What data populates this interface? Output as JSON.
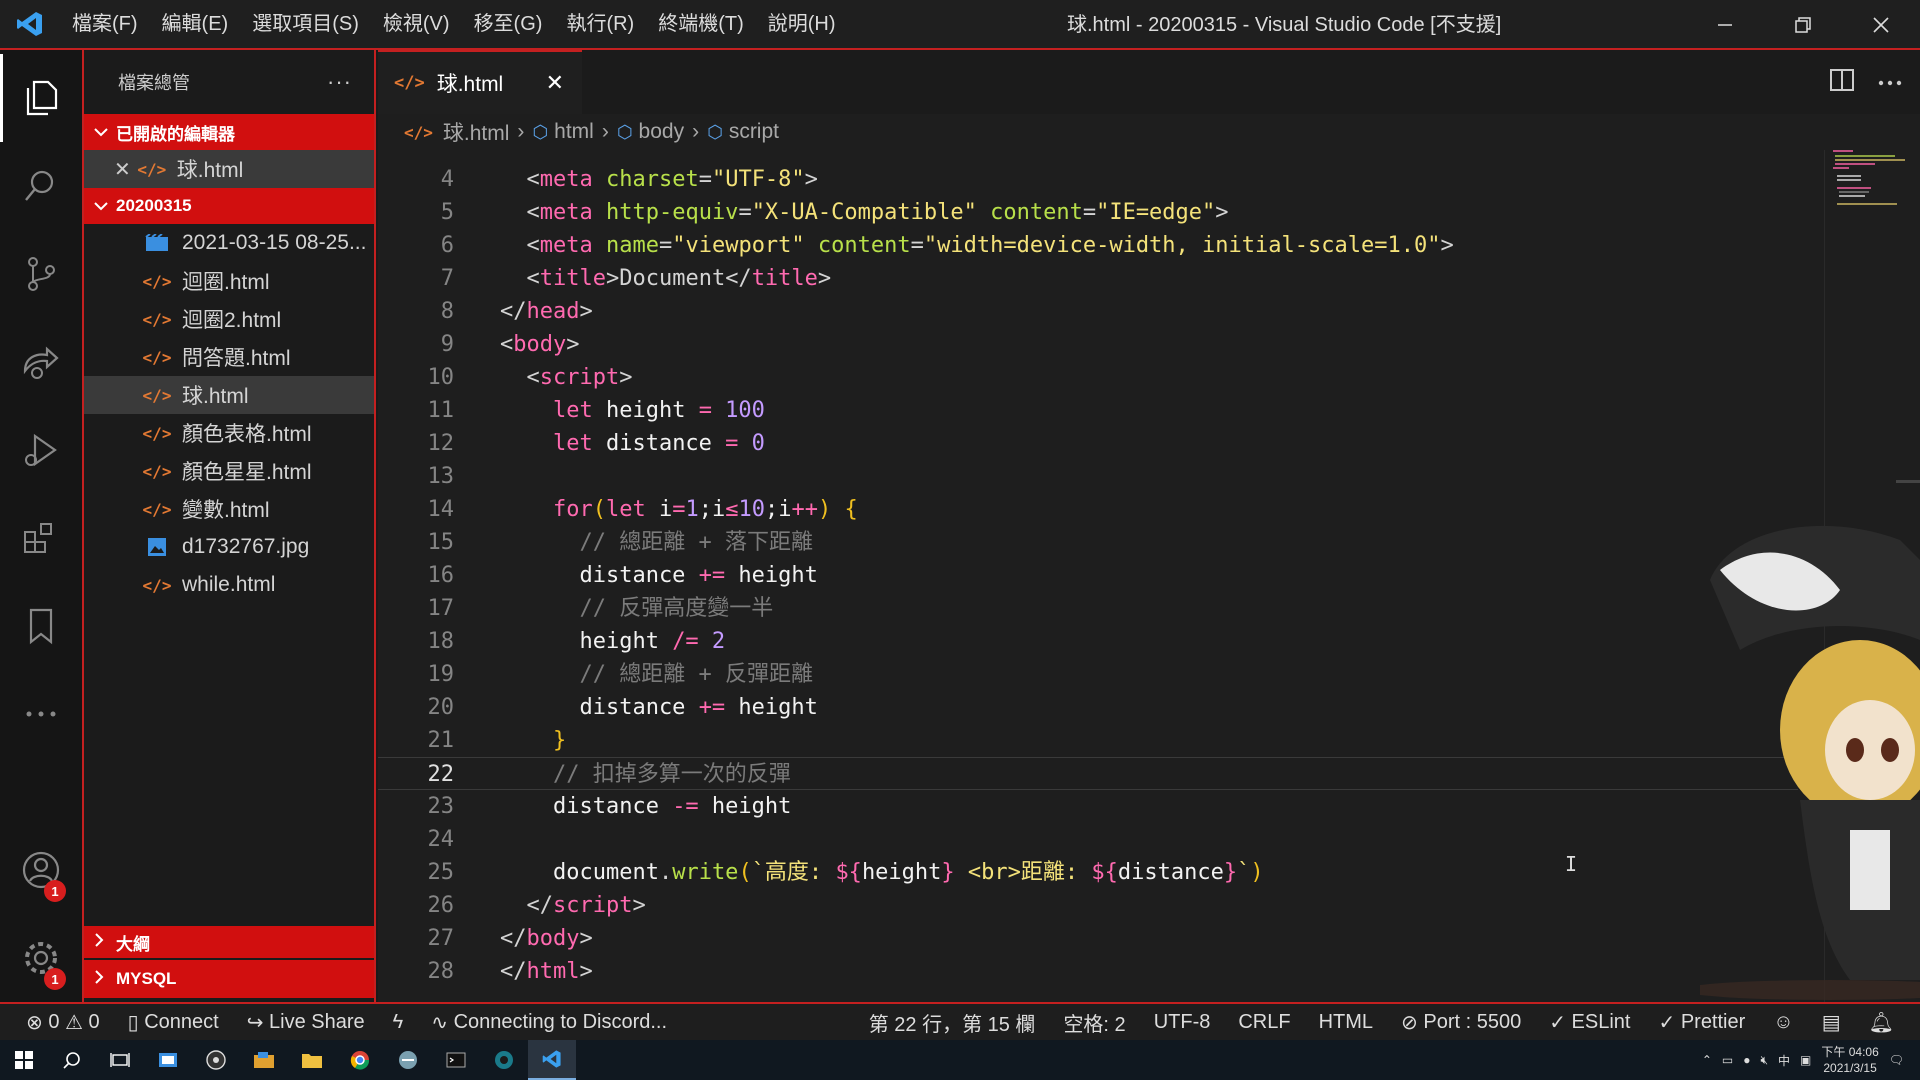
{
  "window": {
    "menu": [
      "檔案(F)",
      "編輯(E)",
      "選取項目(S)",
      "檢視(V)",
      "移至(G)",
      "執行(R)",
      "終端機(T)",
      "說明(H)"
    ],
    "title": "球.html - 20200315 - Visual Studio Code [不支援]"
  },
  "sidebar": {
    "title": "檔案總管",
    "more": "···",
    "open_editors": {
      "label": "已開啟的編輯器",
      "items": [
        {
          "name": "球.html",
          "icon": "html-file-icon"
        }
      ]
    },
    "folder": {
      "label": "20200315",
      "items": [
        {
          "name": "2021-03-15 08-25...",
          "icon": "video-file-icon"
        },
        {
          "name": "迴圈.html",
          "icon": "html-file-icon"
        },
        {
          "name": "迴圈2.html",
          "icon": "html-file-icon"
        },
        {
          "name": "問答題.html",
          "icon": "html-file-icon"
        },
        {
          "name": "球.html",
          "icon": "html-file-icon",
          "selected": true
        },
        {
          "name": "顏色表格.html",
          "icon": "html-file-icon"
        },
        {
          "name": "顏色星星.html",
          "icon": "html-file-icon"
        },
        {
          "name": "變數.html",
          "icon": "html-file-icon"
        },
        {
          "name": "d1732767.jpg",
          "icon": "image-file-icon"
        },
        {
          "name": "while.html",
          "icon": "html-file-icon"
        }
      ]
    },
    "outline_label": "大綱",
    "mysql_label": "MYSQL"
  },
  "activity": {
    "accounts_badge": "1",
    "manage_badge": "1"
  },
  "editor": {
    "tab_label": "球.html",
    "breadcrumb": [
      "球.html",
      "html",
      "body",
      "script"
    ],
    "current_line": 22,
    "lines": [
      {
        "n": "4",
        "tokens": [
          [
            "p",
            "  <"
          ],
          [
            "t",
            "meta"
          ],
          [
            "a",
            " charset"
          ],
          [
            "p",
            "="
          ],
          [
            "s",
            "\"UTF-8\""
          ],
          [
            "p",
            ">"
          ]
        ]
      },
      {
        "n": "5",
        "tokens": [
          [
            "p",
            "  <"
          ],
          [
            "t",
            "meta"
          ],
          [
            "a",
            " http-equiv"
          ],
          [
            "p",
            "="
          ],
          [
            "s",
            "\"X-UA-Compatible\""
          ],
          [
            "a",
            " content"
          ],
          [
            "p",
            "="
          ],
          [
            "s",
            "\"IE=edge\""
          ],
          [
            "p",
            ">"
          ]
        ]
      },
      {
        "n": "6",
        "tokens": [
          [
            "p",
            "  <"
          ],
          [
            "t",
            "meta"
          ],
          [
            "a",
            " name"
          ],
          [
            "p",
            "="
          ],
          [
            "s",
            "\"viewport\""
          ],
          [
            "a",
            " content"
          ],
          [
            "p",
            "="
          ],
          [
            "s",
            "\"width=device-width, initial-scale=1.0\""
          ],
          [
            "p",
            ">"
          ]
        ]
      },
      {
        "n": "7",
        "tokens": [
          [
            "p",
            "  <"
          ],
          [
            "t",
            "title"
          ],
          [
            "p",
            ">Document</"
          ],
          [
            "t",
            "title"
          ],
          [
            "p",
            ">"
          ]
        ]
      },
      {
        "n": "8",
        "tokens": [
          [
            "p",
            "</"
          ],
          [
            "t",
            "head"
          ],
          [
            "p",
            ">"
          ]
        ]
      },
      {
        "n": "9",
        "tokens": [
          [
            "p",
            "<"
          ],
          [
            "t",
            "body"
          ],
          [
            "p",
            ">"
          ]
        ]
      },
      {
        "n": "10",
        "tokens": [
          [
            "p",
            "  <"
          ],
          [
            "t",
            "script"
          ],
          [
            "p",
            ">"
          ]
        ]
      },
      {
        "n": "11",
        "tokens": [
          [
            "k",
            "    let"
          ],
          [
            "w",
            " height "
          ],
          [
            "k",
            "="
          ],
          [
            "n",
            " 100"
          ]
        ]
      },
      {
        "n": "12",
        "tokens": [
          [
            "k",
            "    let"
          ],
          [
            "w",
            " distance "
          ],
          [
            "k",
            "="
          ],
          [
            "n",
            " 0"
          ]
        ]
      },
      {
        "n": "13",
        "tokens": []
      },
      {
        "n": "14",
        "tokens": [
          [
            "k",
            "    for"
          ],
          [
            "br",
            "("
          ],
          [
            "k",
            "let"
          ],
          [
            "w",
            " i"
          ],
          [
            "k",
            "="
          ],
          [
            "n",
            "1"
          ],
          [
            "w",
            ";i"
          ],
          [
            "k",
            "≤"
          ],
          [
            "n",
            "10"
          ],
          [
            "w",
            ";i"
          ],
          [
            "k",
            "++"
          ],
          [
            "br",
            ")"
          ],
          [
            "br",
            " {"
          ]
        ]
      },
      {
        "n": "15",
        "tokens": [
          [
            "cm",
            "      // 總距離 + 落下距離"
          ]
        ]
      },
      {
        "n": "16",
        "tokens": [
          [
            "w",
            "      distance "
          ],
          [
            "k",
            "+="
          ],
          [
            "w",
            " height"
          ]
        ]
      },
      {
        "n": "17",
        "tokens": [
          [
            "cm",
            "      // 反彈高度變一半"
          ]
        ]
      },
      {
        "n": "18",
        "tokens": [
          [
            "w",
            "      height "
          ],
          [
            "k",
            "/="
          ],
          [
            "n",
            " 2"
          ]
        ]
      },
      {
        "n": "19",
        "tokens": [
          [
            "cm",
            "      // 總距離 + 反彈距離"
          ]
        ]
      },
      {
        "n": "20",
        "tokens": [
          [
            "w",
            "      distance "
          ],
          [
            "k",
            "+="
          ],
          [
            "w",
            " height"
          ]
        ]
      },
      {
        "n": "21",
        "tokens": [
          [
            "br",
            "    }"
          ]
        ]
      },
      {
        "n": "22",
        "tokens": [
          [
            "cm",
            "    // 扣掉多算一次的反彈"
          ]
        ]
      },
      {
        "n": "23",
        "tokens": [
          [
            "w",
            "    distance "
          ],
          [
            "k",
            "-="
          ],
          [
            "w",
            " height"
          ]
        ]
      },
      {
        "n": "24",
        "tokens": []
      },
      {
        "n": "25",
        "tokens": [
          [
            "w",
            "    document"
          ],
          [
            "p",
            "."
          ],
          [
            "f",
            "write"
          ],
          [
            "br",
            "("
          ],
          [
            "s",
            "`高度: "
          ],
          [
            "k",
            "${"
          ],
          [
            "w",
            "height"
          ],
          [
            "k",
            "}"
          ],
          [
            "s",
            " <br>距離: "
          ],
          [
            "k",
            "${"
          ],
          [
            "w",
            "distance"
          ],
          [
            "k",
            "}"
          ],
          [
            "s",
            "`"
          ],
          [
            "br",
            ")"
          ]
        ]
      },
      {
        "n": "26",
        "tokens": [
          [
            "p",
            "  </"
          ],
          [
            "t",
            "script"
          ],
          [
            "p",
            ">"
          ]
        ]
      },
      {
        "n": "27",
        "tokens": [
          [
            "p",
            "</"
          ],
          [
            "t",
            "body"
          ],
          [
            "p",
            ">"
          ]
        ]
      },
      {
        "n": "28",
        "tokens": [
          [
            "p",
            "</"
          ],
          [
            "t",
            "html"
          ],
          [
            "p",
            ">"
          ]
        ]
      }
    ]
  },
  "status": {
    "errors": "0",
    "warnings": "0",
    "connect": "Connect",
    "live_share": "Live Share",
    "discord": "Connecting to Discord...",
    "position": "第 22 行，第 15 欄",
    "spaces": "空格: 2",
    "encoding": "UTF-8",
    "eol": "CRLF",
    "language": "HTML",
    "port": "Port : 5500",
    "eslint": "ESLint",
    "prettier": "Prettier"
  },
  "taskbar": {
    "time": "下午 04:06",
    "date": "2021/3/15",
    "ime": "中"
  },
  "colors": {
    "accent": "#c42020",
    "section": "#d10f0f",
    "tag": "#ff6ab0",
    "attr": "#b8e04a",
    "string": "#f4e27a",
    "number": "#c49bff",
    "comment": "#7b7b7b"
  }
}
